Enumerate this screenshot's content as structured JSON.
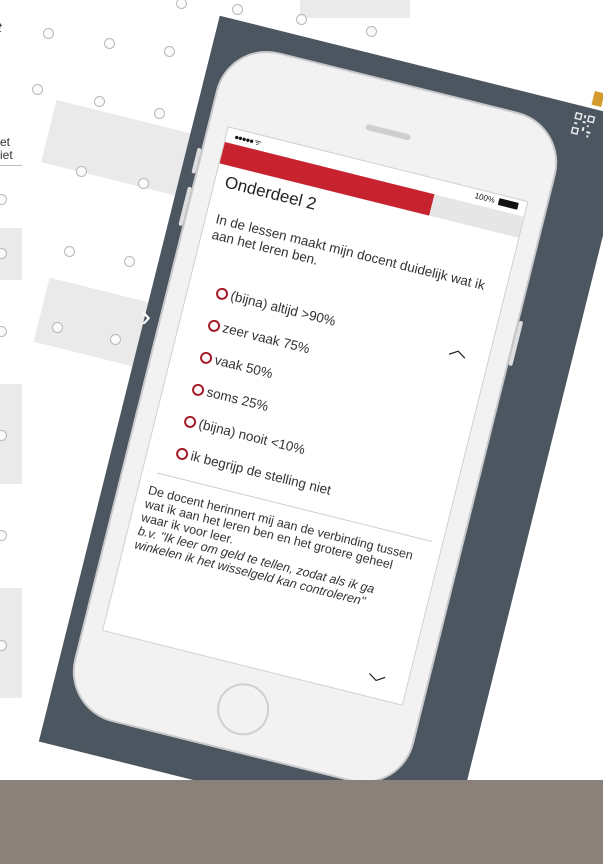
{
  "background_sheet": {
    "italic_fragment": "t",
    "header_fragment_1": "et",
    "header_fragment_2": "iet"
  },
  "presenter": {
    "nav_next_icon": "chevron-right-icon",
    "qr_icon": "qr-code-icon"
  },
  "phone": {
    "status_bar": {
      "signal": "●●●●● ᯤ",
      "battery_text": "100%",
      "battery_icon": "battery-full-icon"
    },
    "progress": {
      "fraction": 0.7,
      "color": "#c7232f"
    },
    "section_title": "Onderdeel 2",
    "question": "In de lessen maakt mijn docent duidelijk wat ik aan het leren ben.",
    "options": [
      "(bijna) altijd >90%",
      "zeer vaak 75%",
      "vaak 50%",
      "soms 25%",
      "(bijna) nooit <10%",
      "ik begrijp de stelling niet"
    ],
    "next_statement": "De docent herinnert mij aan de verbinding tussen wat ik aan het leren ben en het grotere geheel waar ik voor leer.",
    "next_example": "b.v. \"Ik leer om geld te tellen, zodat als ik ga winkelen ik het wisselgeld kan controleren\"",
    "up_icon": "chevron-up-icon",
    "down_icon": "chevron-down-icon"
  },
  "colors": {
    "panel": "#4b5661",
    "accent_red": "#c7232f",
    "footer": "#8a817b"
  }
}
